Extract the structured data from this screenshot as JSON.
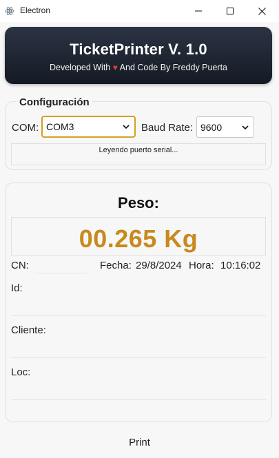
{
  "window": {
    "title": "Electron"
  },
  "header": {
    "title": "TicketPrinter V. 1.0",
    "subtitle_before": "Developed With",
    "heart": "♥",
    "subtitle_after": "And Code By Freddy Puerta"
  },
  "config": {
    "legend": "Configuración",
    "com_label": "COM:",
    "com_value": "COM3",
    "baud_label": "Baud Rate:",
    "baud_value": "9600",
    "status": "Leyendo puerto serial..."
  },
  "weight": {
    "title": "Peso:",
    "value": "00.265 Kg",
    "cn_label": "CN:",
    "fecha_label": "Fecha:",
    "fecha_value": "29/8/2024",
    "hora_label": "Hora:",
    "hora_value": "10:16:02",
    "id_label": "Id:",
    "cliente_label": "Cliente:",
    "loc_label": "Loc:"
  },
  "actions": {
    "print_label": "Print"
  },
  "colors": {
    "accent": "#c8891e",
    "focus_border": "#d4a020",
    "header_bg": "#1c2230",
    "heart": "#e23b3b"
  }
}
